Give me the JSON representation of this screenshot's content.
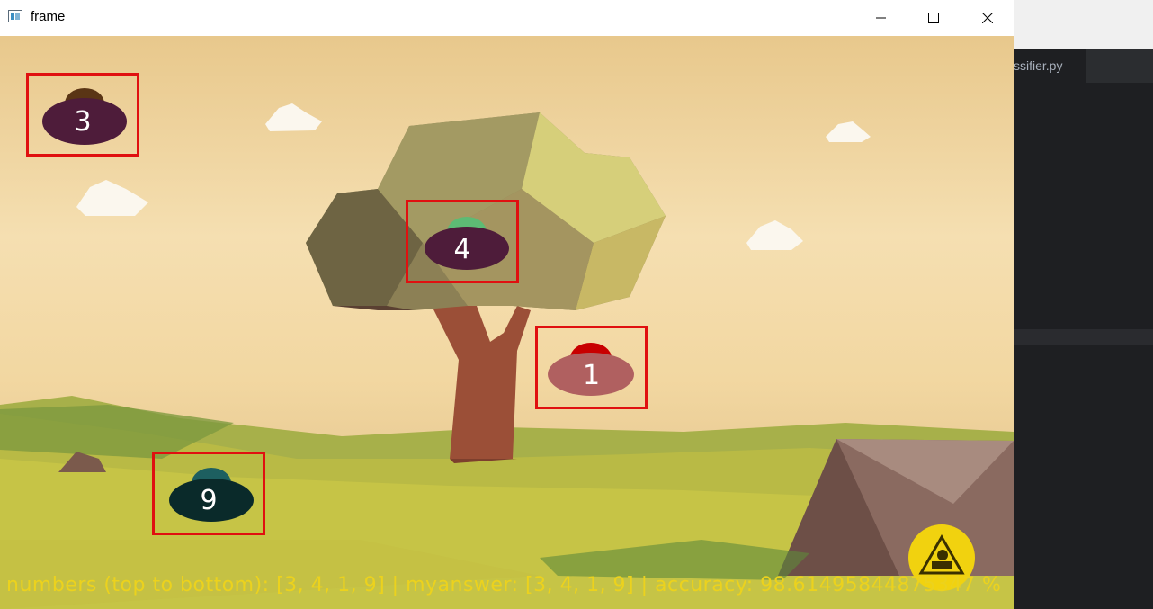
{
  "window": {
    "title": "frame",
    "icon": "app-icon",
    "controls": [
      "minimize-icon",
      "maximize-icon",
      "close-icon"
    ]
  },
  "editor": {
    "tab_label": "ssifier.py"
  },
  "game": {
    "ufos": [
      {
        "number": "3",
        "body_color": "#4e1c3a",
        "dome_color": "#5a3515"
      },
      {
        "number": "4",
        "body_color": "#4e1c3a",
        "dome_color": "#5dbb74"
      },
      {
        "number": "1",
        "body_color": "#b06060",
        "dome_color": "#c80000"
      },
      {
        "number": "9",
        "body_color": "#0a2a2a",
        "dome_color": "#1d5f60"
      }
    ],
    "status": "numbers (top to bottom): [3, 4, 1, 9] | myanswer: [3, 4, 1, 9] | accuracy: 98.61495844875347 %",
    "detection_color": "#e01010",
    "status_color": "#ecd21d",
    "badge_icon": "warning-sign-icon"
  }
}
